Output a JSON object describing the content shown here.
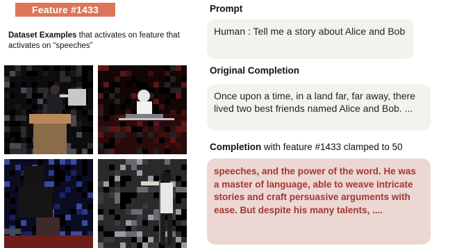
{
  "feature_badge": "Feature #1433",
  "dataset": {
    "bold": "Dataset Examples",
    "rest": " that activates on feature that activates on “speeches”"
  },
  "thumbnails": [
    "speaker-at-podium",
    "speaker-at-keyboard",
    "speaker-at-lectern",
    "speaker-with-microphone"
  ],
  "prompt": {
    "label": "Prompt",
    "text": "Human : Tell me a story about Alice and Bob"
  },
  "original": {
    "label": "Original Completion",
    "text": "Once upon a time, in a land far, far away, there lived two best friends named Alice and Bob. ..."
  },
  "completion": {
    "label_bold": "Completion",
    "label_rest": " with feature #1433 clamped to 50",
    "text": "speeches, and the power of the word. He was a master of language, able to weave intricate stories and craft persuasive arguments with ease. But despite his many talents, ...."
  },
  "colors": {
    "badge_bg": "#db7659",
    "text_box_bg": "#f3f3ee",
    "completion_bg": "#ecd7d3",
    "completion_text": "#a23832"
  }
}
